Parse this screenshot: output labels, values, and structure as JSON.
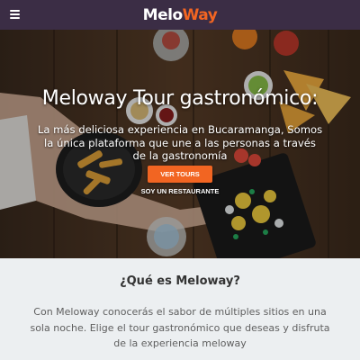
{
  "navbar": {
    "logo_part1": "Melo",
    "logo_part2": "Way",
    "brand_color": "#f26522",
    "bar_color": "#3b2d45",
    "menu_icon": "hamburger-menu-icon"
  },
  "hero": {
    "title": "Meloway Tour gastronómico:",
    "subtitle": "La más deliciosa experiencia en Bucaramanga, Somos la única plataforma que une a las personas a través de la gastronomía",
    "primary_button": "VER TOURS",
    "secondary_link": "SOY UN RESTAURANTE",
    "background_image": "food-table-photo"
  },
  "about": {
    "title": "¿Qué es Meloway?",
    "text": "Con Meloway conocerás el sabor de múltiples sitios en una sola noche. Elige el tour gastronómico que deseas y disfruta de la experiencia meloway"
  }
}
